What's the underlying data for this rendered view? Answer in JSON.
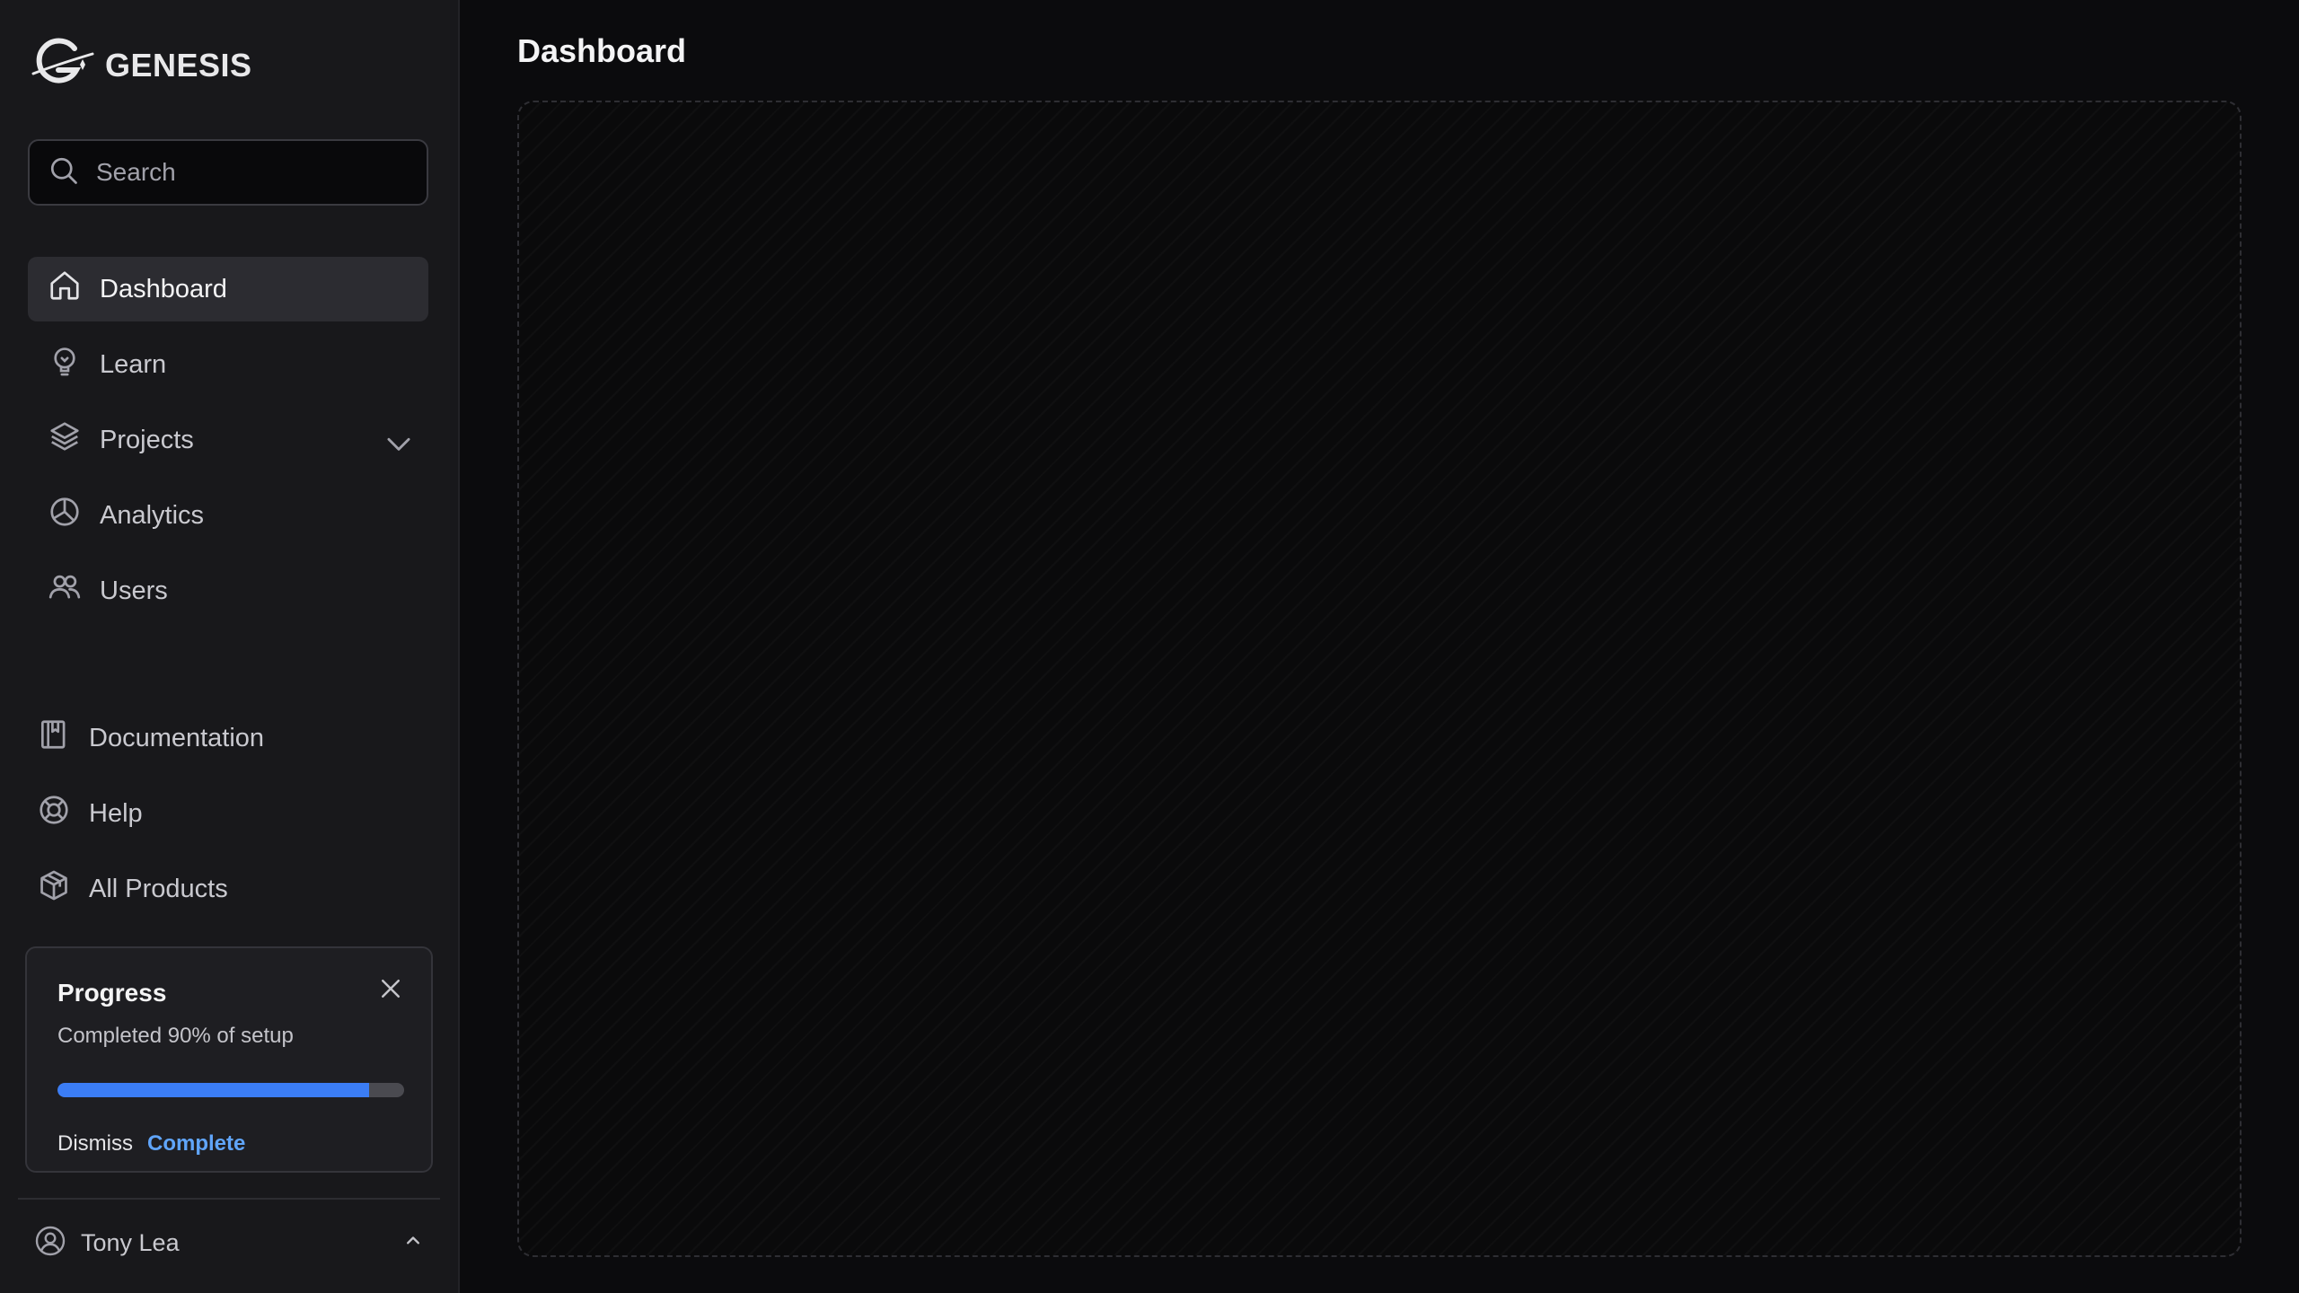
{
  "brand": {
    "name": "GENESIS"
  },
  "search": {
    "placeholder": "Search"
  },
  "nav": {
    "items": [
      {
        "label": "Dashboard",
        "icon": "home-icon",
        "active": true
      },
      {
        "label": "Learn",
        "icon": "lightbulb-icon"
      },
      {
        "label": "Projects",
        "icon": "layers-icon",
        "expandable": true
      },
      {
        "label": "Analytics",
        "icon": "pie-chart-icon"
      },
      {
        "label": "Users",
        "icon": "users-icon"
      }
    ]
  },
  "secondary_nav": {
    "items": [
      {
        "label": "Documentation",
        "icon": "book-icon"
      },
      {
        "label": "Help",
        "icon": "lifebuoy-icon"
      },
      {
        "label": "All Products",
        "icon": "package-icon"
      }
    ]
  },
  "progress": {
    "title": "Progress",
    "subtitle": "Completed 90% of setup",
    "percent": 90,
    "dismiss_label": "Dismiss",
    "complete_label": "Complete"
  },
  "user": {
    "name": "Tony Lea"
  },
  "main": {
    "title": "Dashboard"
  },
  "colors": {
    "accent": "#3b7df5",
    "link": "#60a5fa",
    "sidebar_bg": "#18181b",
    "main_bg": "#0b0b0d"
  }
}
